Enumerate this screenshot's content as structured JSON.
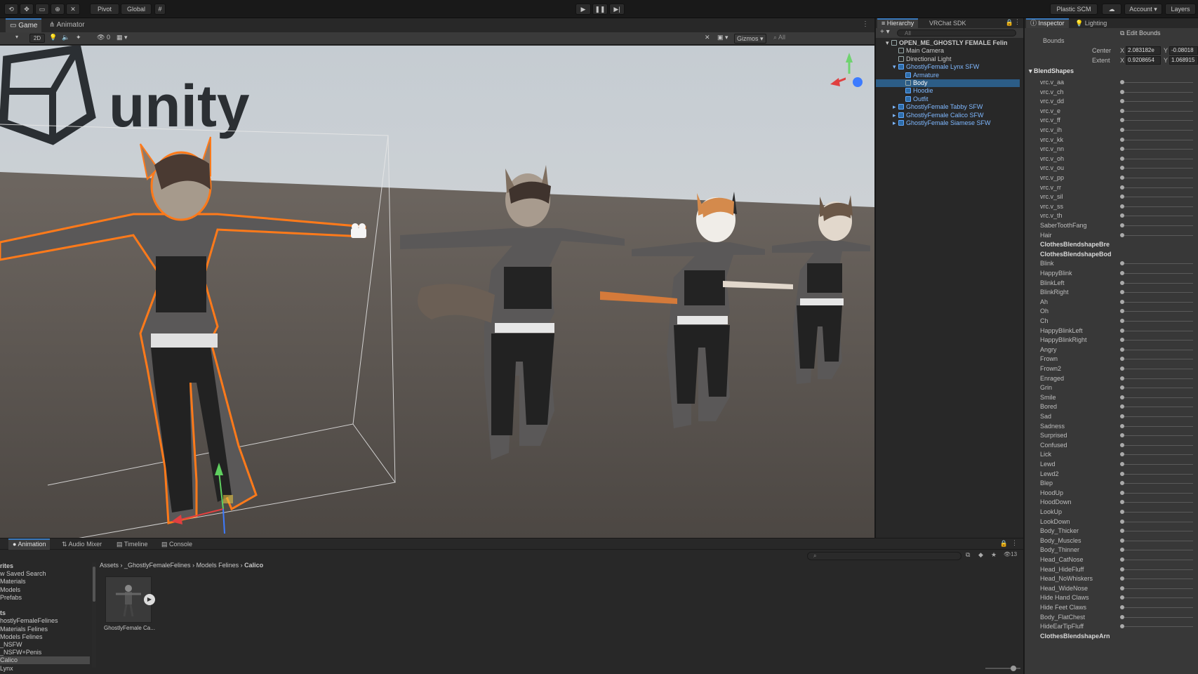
{
  "toolbar": {
    "pivot": "Pivot",
    "global": "Global",
    "plastic": "Plastic SCM",
    "account": "Account",
    "layers": "Layers"
  },
  "scene_tabs": {
    "game": "Game",
    "animator": "Animator"
  },
  "scene_toolbar": {
    "mode_2d": "2D",
    "gizmos": "Gizmos",
    "hidden_count": "0"
  },
  "logo_text": "unity",
  "hierarchy": {
    "tab": "Hierarchy",
    "tab2": "VRChat SDK",
    "search_placeholder": "All",
    "items": [
      {
        "label": "OPEN_ME_GHOSTLY FEMALE Felin",
        "indent": 0,
        "type": "scene"
      },
      {
        "label": "Main Camera",
        "indent": 1,
        "type": "object"
      },
      {
        "label": "Directional Light",
        "indent": 1,
        "type": "object"
      },
      {
        "label": "GhostlyFemale Lynx SFW",
        "indent": 1,
        "type": "prefab"
      },
      {
        "label": "Armature",
        "indent": 2,
        "type": "prefab"
      },
      {
        "label": "Body",
        "indent": 2,
        "type": "selected"
      },
      {
        "label": "Hoodie",
        "indent": 2,
        "type": "prefab"
      },
      {
        "label": "Outfit",
        "indent": 2,
        "type": "prefab"
      },
      {
        "label": "GhostlyFemale Tabby SFW",
        "indent": 1,
        "type": "prefab"
      },
      {
        "label": "GhostlyFemale Calico SFW",
        "indent": 1,
        "type": "prefab"
      },
      {
        "label": "GhostlyFemale Siamese SFW",
        "indent": 1,
        "type": "prefab"
      }
    ]
  },
  "inspector": {
    "tab": "Inspector",
    "tab2": "Lighting",
    "edit_bounds": "Edit Bounds",
    "bounds_label": "Bounds",
    "center_label": "Center",
    "center_x": "2.083182e",
    "center_y": "-0.08018",
    "extent_label": "Extent",
    "extent_x": "0.9208654",
    "extent_y": "1.068915",
    "axis_x": "X",
    "axis_y": "Y",
    "blendshapes_header": "BlendShapes",
    "blendshapes": [
      {
        "name": "vrc.v_aa",
        "header": false
      },
      {
        "name": "vrc.v_ch",
        "header": false
      },
      {
        "name": "vrc.v_dd",
        "header": false
      },
      {
        "name": "vrc.v_e",
        "header": false
      },
      {
        "name": "vrc.v_ff",
        "header": false
      },
      {
        "name": "vrc.v_ih",
        "header": false
      },
      {
        "name": "vrc.v_kk",
        "header": false
      },
      {
        "name": "vrc.v_nn",
        "header": false
      },
      {
        "name": "vrc.v_oh",
        "header": false
      },
      {
        "name": "vrc.v_ou",
        "header": false
      },
      {
        "name": "vrc.v_pp",
        "header": false
      },
      {
        "name": "vrc.v_rr",
        "header": false
      },
      {
        "name": "vrc.v_sil",
        "header": false
      },
      {
        "name": "vrc.v_ss",
        "header": false
      },
      {
        "name": "vrc.v_th",
        "header": false
      },
      {
        "name": "SaberToothFang",
        "header": false
      },
      {
        "name": "Hair",
        "header": false
      },
      {
        "name": "ClothesBlendshapeBre",
        "header": true
      },
      {
        "name": "ClothesBlendshapeBod",
        "header": true
      },
      {
        "name": "Blink",
        "header": false
      },
      {
        "name": "HappyBlink",
        "header": false
      },
      {
        "name": "BlinkLeft",
        "header": false
      },
      {
        "name": "BlinkRight",
        "header": false
      },
      {
        "name": "Ah",
        "header": false
      },
      {
        "name": "Oh",
        "header": false
      },
      {
        "name": "Ch",
        "header": false
      },
      {
        "name": "HappyBlinkLeft",
        "header": false
      },
      {
        "name": "HappyBlinkRight",
        "header": false
      },
      {
        "name": "Angry",
        "header": false
      },
      {
        "name": "Frown",
        "header": false
      },
      {
        "name": "Frown2",
        "header": false
      },
      {
        "name": "Enraged",
        "header": false
      },
      {
        "name": "Grin",
        "header": false
      },
      {
        "name": "Smile",
        "header": false
      },
      {
        "name": "Bored",
        "header": false
      },
      {
        "name": "Sad",
        "header": false
      },
      {
        "name": "Sadness",
        "header": false
      },
      {
        "name": "Surprised",
        "header": false
      },
      {
        "name": "Confused",
        "header": false
      },
      {
        "name": "Lick",
        "header": false
      },
      {
        "name": "Lewd",
        "header": false
      },
      {
        "name": "Lewd2",
        "header": false
      },
      {
        "name": "Blep",
        "header": false
      },
      {
        "name": "HoodUp",
        "header": false
      },
      {
        "name": "HoodDown",
        "header": false
      },
      {
        "name": "LookUp",
        "header": false
      },
      {
        "name": "LookDown",
        "header": false
      },
      {
        "name": "Body_Thicker",
        "header": false
      },
      {
        "name": "Body_Muscles",
        "header": false
      },
      {
        "name": "Body_Thinner",
        "header": false
      },
      {
        "name": "Head_CatNose",
        "header": false
      },
      {
        "name": "Head_HideFluff",
        "header": false
      },
      {
        "name": "Head_NoWhiskers",
        "header": false
      },
      {
        "name": "Head_WideNose",
        "header": false
      },
      {
        "name": "Hide Hand Claws",
        "header": false
      },
      {
        "name": "Hide Feet Claws",
        "header": false
      },
      {
        "name": "Body_FlatChest",
        "header": false
      },
      {
        "name": "HideEarTipFluff",
        "header": false
      },
      {
        "name": "ClothesBlendshapeArn",
        "header": true
      }
    ]
  },
  "bottom_tabs": {
    "animation": "Animation",
    "audio_mixer": "Audio Mixer",
    "timeline": "Timeline",
    "console": "Console"
  },
  "project": {
    "hidden_count": "13",
    "breadcrumb": [
      {
        "label": "Assets"
      },
      {
        "label": "_GhostlyFemaleFelines"
      },
      {
        "label": "Models Felines"
      },
      {
        "label": "Calico"
      }
    ],
    "sidebar": [
      {
        "label": "rites",
        "section": true
      },
      {
        "label": "w Saved Search",
        "section": false
      },
      {
        "label": "Materials",
        "section": false
      },
      {
        "label": "Models",
        "section": false
      },
      {
        "label": "Prefabs",
        "section": false
      },
      {
        "label": "",
        "section": false
      },
      {
        "label": "ts",
        "section": true
      },
      {
        "label": "hostlyFemaleFelines",
        "section": false
      },
      {
        "label": "Materials Felines",
        "section": false
      },
      {
        "label": "Models Felines",
        "section": false
      },
      {
        "label": "_NSFW",
        "section": false
      },
      {
        "label": "_NSFW+Penis",
        "section": false
      },
      {
        "label": "Calico",
        "section": false,
        "selected": true
      },
      {
        "label": "Lynx",
        "section": false
      }
    ],
    "asset_name": "GhostlyFemale Ca..."
  },
  "colors": {
    "accent": "#3a79bb",
    "selection": "#2c5d87",
    "prefab_text": "#7fb8ff",
    "outline": "#ff7a1a"
  }
}
